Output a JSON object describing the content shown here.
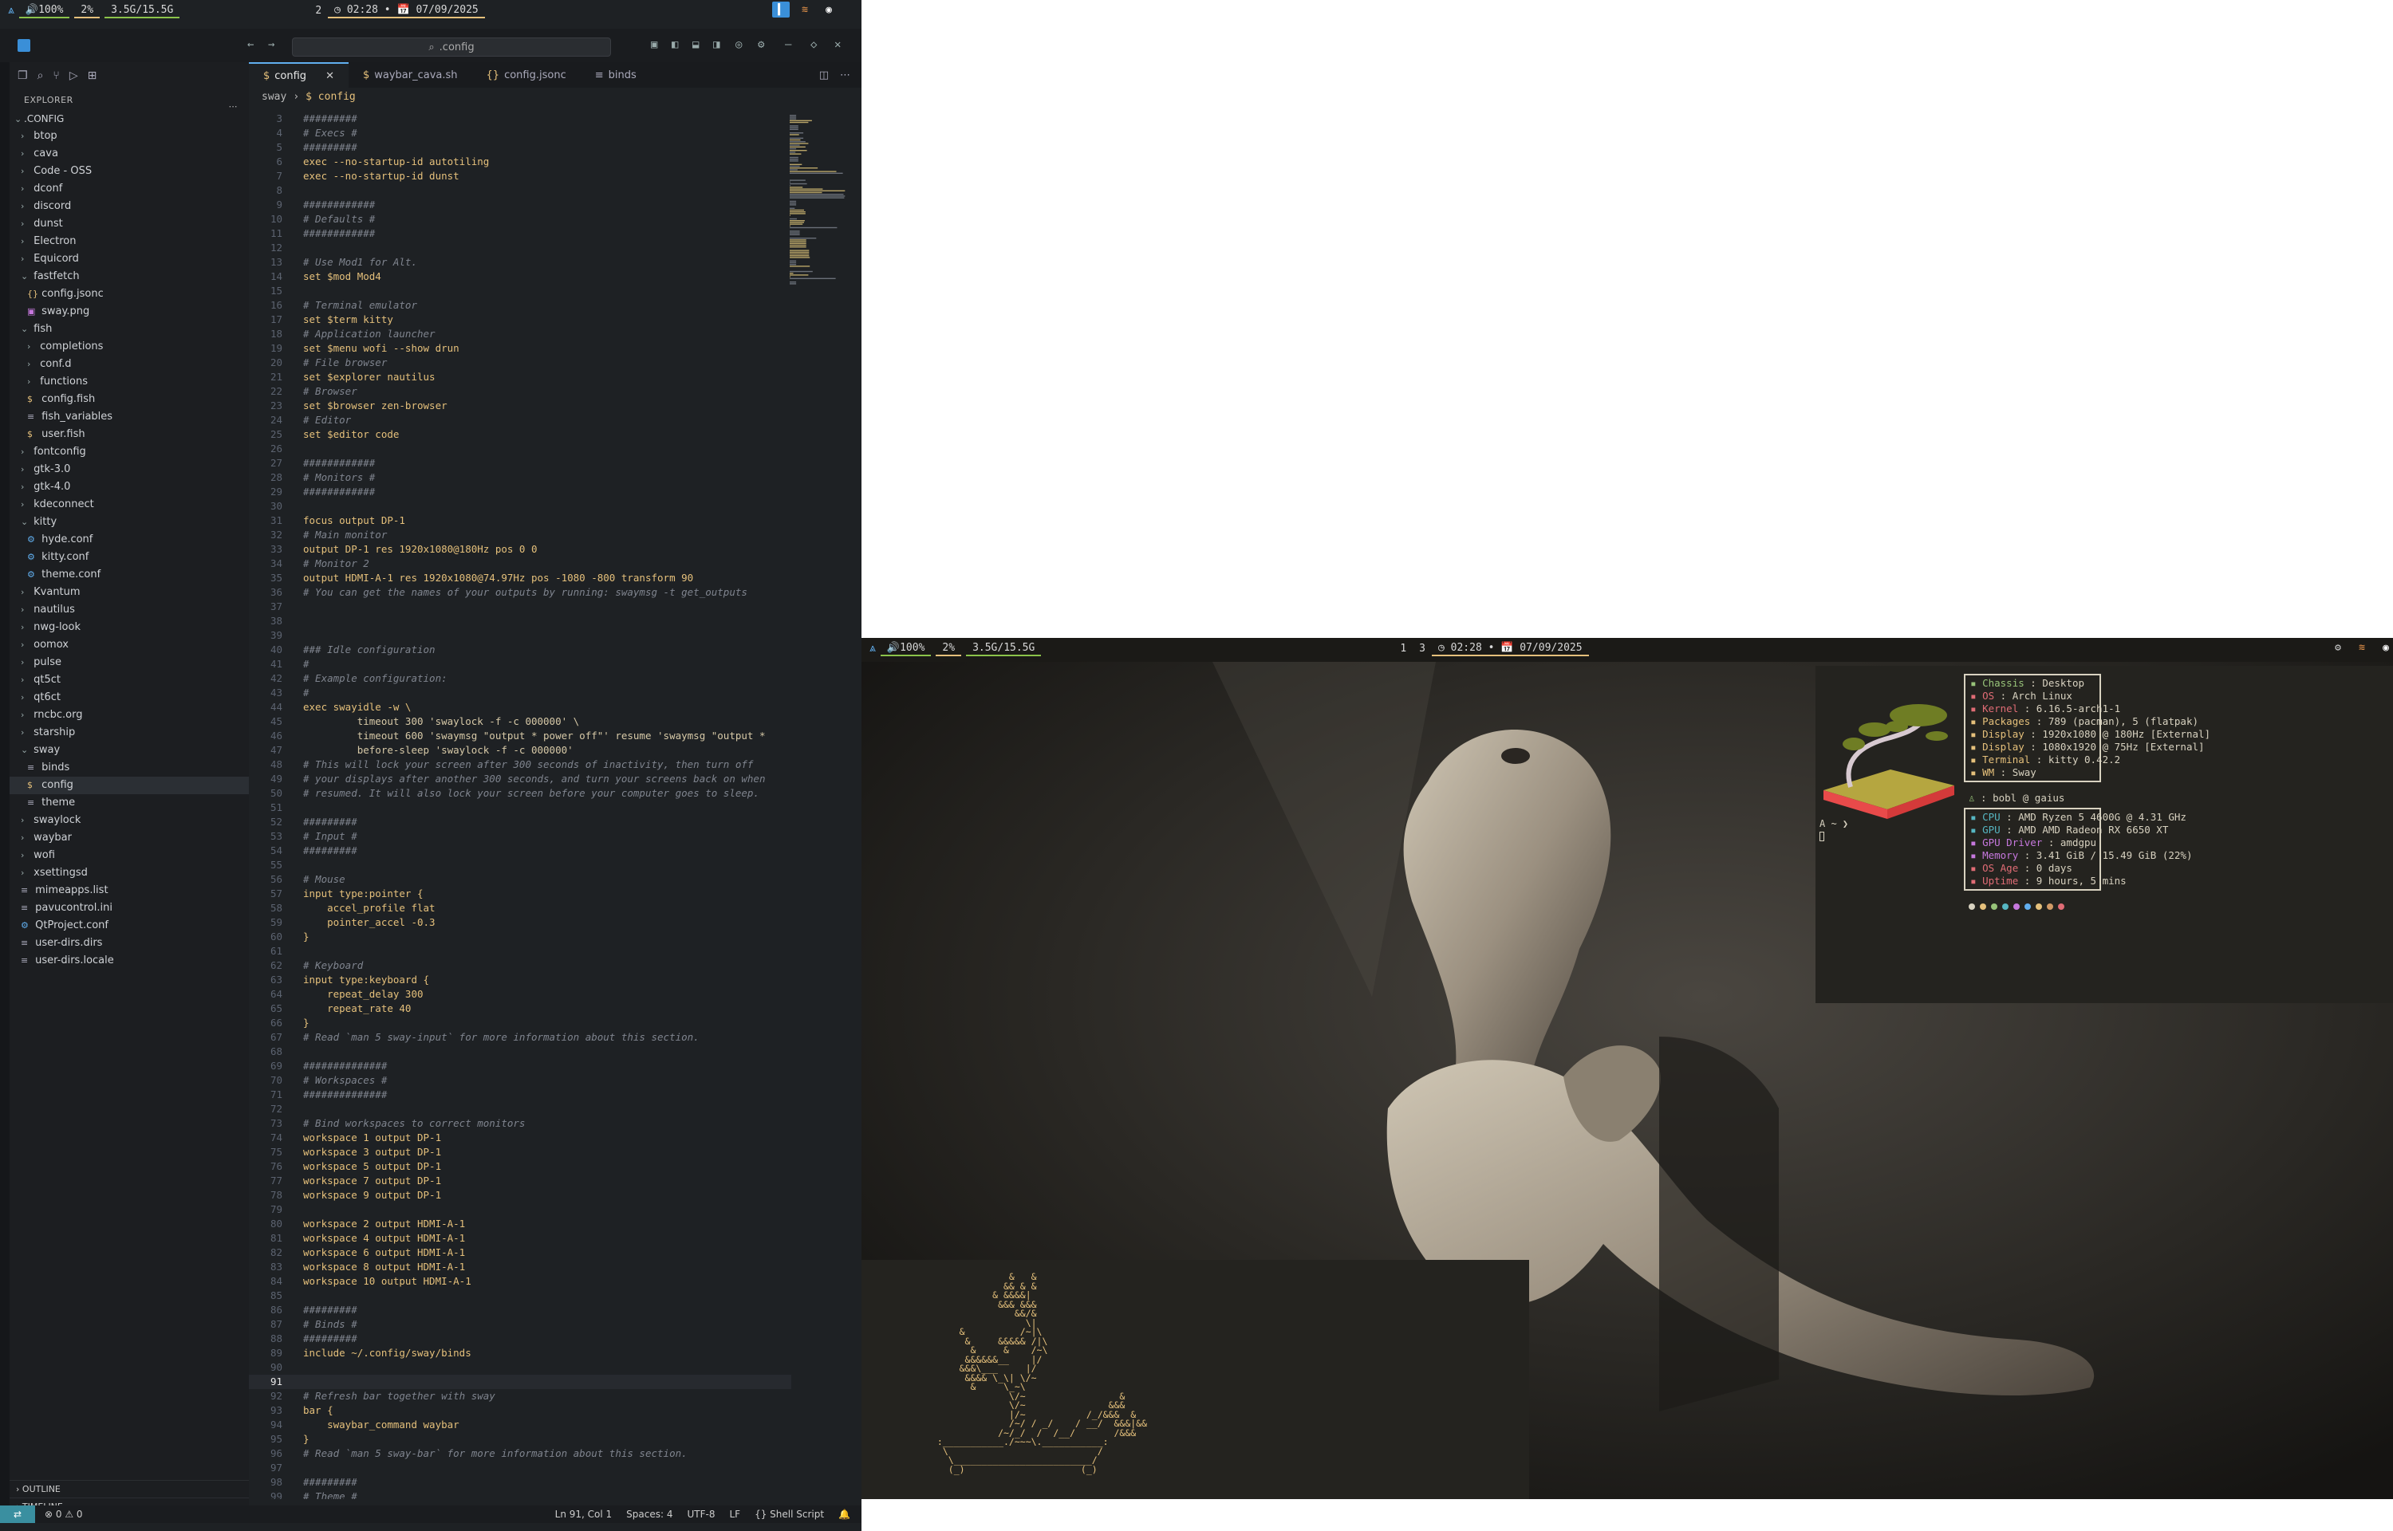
{
  "top_bar": {
    "logo": "arch-icon",
    "volume": "🔊100%",
    "cpu": "2%",
    "memory": "3.5G/15.5G",
    "workspaces": [
      "2"
    ],
    "time": "02:28",
    "date": "07/09/2025",
    "clock_text": "◷ 02:28 • 📅 07/09/2025"
  },
  "right_bar": {
    "volume": "🔊100%",
    "cpu": "2%",
    "memory": "3.5G/15.5G",
    "workspaces": [
      "1",
      "3"
    ],
    "clock_text": "◷ 02:28 • 📅 07/09/2025"
  },
  "vscode": {
    "search_placeholder": ".config",
    "explorer_title": "EXPLORER",
    "root": ".CONFIG",
    "tree": [
      {
        "name": "btop",
        "type": "folder",
        "depth": 1,
        "open": false
      },
      {
        "name": "cava",
        "type": "folder",
        "depth": 1,
        "open": false
      },
      {
        "name": "Code - OSS",
        "type": "folder",
        "depth": 1,
        "open": false
      },
      {
        "name": "dconf",
        "type": "folder",
        "depth": 1,
        "open": false
      },
      {
        "name": "discord",
        "type": "folder",
        "depth": 1,
        "open": false
      },
      {
        "name": "dunst",
        "type": "folder",
        "depth": 1,
        "open": false
      },
      {
        "name": "Electron",
        "type": "folder",
        "depth": 1,
        "open": false
      },
      {
        "name": "Equicord",
        "type": "folder",
        "depth": 1,
        "open": false
      },
      {
        "name": "fastfetch",
        "type": "folder",
        "depth": 1,
        "open": true
      },
      {
        "name": "config.jsonc",
        "type": "json",
        "depth": 2
      },
      {
        "name": "sway.png",
        "type": "img",
        "depth": 2
      },
      {
        "name": "fish",
        "type": "folder",
        "depth": 1,
        "open": true
      },
      {
        "name": "completions",
        "type": "folder",
        "depth": 2,
        "open": false
      },
      {
        "name": "conf.d",
        "type": "folder",
        "depth": 2,
        "open": false
      },
      {
        "name": "functions",
        "type": "folder",
        "depth": 2,
        "open": false
      },
      {
        "name": "config.fish",
        "type": "shell",
        "depth": 2
      },
      {
        "name": "fish_variables",
        "type": "text",
        "depth": 2
      },
      {
        "name": "user.fish",
        "type": "shell",
        "depth": 2
      },
      {
        "name": "fontconfig",
        "type": "folder",
        "depth": 1,
        "open": false
      },
      {
        "name": "gtk-3.0",
        "type": "folder",
        "depth": 1,
        "open": false
      },
      {
        "name": "gtk-4.0",
        "type": "folder",
        "depth": 1,
        "open": false
      },
      {
        "name": "kdeconnect",
        "type": "folder",
        "depth": 1,
        "open": false
      },
      {
        "name": "kitty",
        "type": "folder",
        "depth": 1,
        "open": true
      },
      {
        "name": "hyde.conf",
        "type": "gear",
        "depth": 2
      },
      {
        "name": "kitty.conf",
        "type": "gear",
        "depth": 2
      },
      {
        "name": "theme.conf",
        "type": "gear",
        "depth": 2
      },
      {
        "name": "Kvantum",
        "type": "folder",
        "depth": 1,
        "open": false
      },
      {
        "name": "nautilus",
        "type": "folder",
        "depth": 1,
        "open": false
      },
      {
        "name": "nwg-look",
        "type": "folder",
        "depth": 1,
        "open": false
      },
      {
        "name": "oomox",
        "type": "folder",
        "depth": 1,
        "open": false
      },
      {
        "name": "pulse",
        "type": "folder",
        "depth": 1,
        "open": false
      },
      {
        "name": "qt5ct",
        "type": "folder",
        "depth": 1,
        "open": false
      },
      {
        "name": "qt6ct",
        "type": "folder",
        "depth": 1,
        "open": false
      },
      {
        "name": "rncbc.org",
        "type": "folder",
        "depth": 1,
        "open": false
      },
      {
        "name": "starship",
        "type": "folder",
        "depth": 1,
        "open": false
      },
      {
        "name": "sway",
        "type": "folder",
        "depth": 1,
        "open": true
      },
      {
        "name": "binds",
        "type": "text",
        "depth": 2
      },
      {
        "name": "config",
        "type": "shell",
        "depth": 2,
        "selected": true
      },
      {
        "name": "theme",
        "type": "text",
        "depth": 2
      },
      {
        "name": "swaylock",
        "type": "folder",
        "depth": 1,
        "open": false
      },
      {
        "name": "waybar",
        "type": "folder",
        "depth": 1,
        "open": false
      },
      {
        "name": "wofi",
        "type": "folder",
        "depth": 1,
        "open": false
      },
      {
        "name": "xsettingsd",
        "type": "folder",
        "depth": 1,
        "open": false
      },
      {
        "name": "mimeapps.list",
        "type": "text",
        "depth": 1
      },
      {
        "name": "pavucontrol.ini",
        "type": "text",
        "depth": 1
      },
      {
        "name": "QtProject.conf",
        "type": "gear",
        "depth": 1
      },
      {
        "name": "user-dirs.dirs",
        "type": "text",
        "depth": 1
      },
      {
        "name": "user-dirs.locale",
        "type": "text",
        "depth": 1
      }
    ],
    "outline_label": "OUTLINE",
    "timeline_label": "TIMELINE",
    "tabs": [
      {
        "label": "config",
        "icon": "$",
        "active": true
      },
      {
        "label": "waybar_cava.sh",
        "icon": "$",
        "active": false
      },
      {
        "label": "config.jsonc",
        "icon": "{}",
        "active": false
      },
      {
        "label": "binds",
        "icon": "≡",
        "active": false
      }
    ],
    "breadcrumb": [
      "sway",
      "$ config"
    ],
    "current_line": 91,
    "code_lines": [
      [
        3,
        "#########",
        "cm"
      ],
      [
        4,
        "# Execs #",
        "cm"
      ],
      [
        5,
        "#########",
        "cm"
      ],
      [
        6,
        "exec --no-startup-id autotiling",
        "k"
      ],
      [
        7,
        "exec --no-startup-id dunst",
        "k"
      ],
      [
        8,
        "",
        ""
      ],
      [
        9,
        "############",
        "cm"
      ],
      [
        10,
        "# Defaults #",
        "cm"
      ],
      [
        11,
        "############",
        "cm"
      ],
      [
        12,
        "",
        ""
      ],
      [
        13,
        "# Use Mod1 for Alt.",
        "cm"
      ],
      [
        14,
        "set $mod Mod4",
        "k"
      ],
      [
        15,
        "",
        ""
      ],
      [
        16,
        "# Terminal emulator",
        "cm"
      ],
      [
        17,
        "set $term kitty",
        "k"
      ],
      [
        18,
        "# Application launcher",
        "cm"
      ],
      [
        19,
        "set $menu wofi --show drun",
        "k"
      ],
      [
        20,
        "# File browser",
        "cm"
      ],
      [
        21,
        "set $explorer nautilus",
        "k"
      ],
      [
        22,
        "# Browser",
        "cm"
      ],
      [
        23,
        "set $browser zen-browser",
        "k"
      ],
      [
        24,
        "# Editor",
        "cm"
      ],
      [
        25,
        "set $editor code",
        "k"
      ],
      [
        26,
        "",
        ""
      ],
      [
        27,
        "############",
        "cm"
      ],
      [
        28,
        "# Monitors #",
        "cm"
      ],
      [
        29,
        "############",
        "cm"
      ],
      [
        30,
        "",
        ""
      ],
      [
        31,
        "focus output DP-1",
        "k"
      ],
      [
        32,
        "# Main monitor",
        "cm"
      ],
      [
        33,
        "output DP-1 res 1920x1080@180Hz pos 0 0",
        "k"
      ],
      [
        34,
        "# Monitor 2",
        "cm"
      ],
      [
        35,
        "output HDMI-A-1 res 1920x1080@74.97Hz pos -1080 -800 transform 90",
        "k"
      ],
      [
        36,
        "# You can get the names of your outputs by running: swaymsg -t get_outputs",
        "cm"
      ],
      [
        37,
        "",
        ""
      ],
      [
        38,
        "",
        ""
      ],
      [
        39,
        "",
        ""
      ],
      [
        40,
        "### Idle configuration",
        "cm"
      ],
      [
        41,
        "#",
        "cm"
      ],
      [
        42,
        "# Example configuration:",
        "cm"
      ],
      [
        43,
        "#",
        "cm"
      ],
      [
        44,
        "exec swayidle -w \\",
        "k"
      ],
      [
        45,
        "         timeout 300 'swaylock -f -c 000000' \\",
        "t"
      ],
      [
        46,
        "         timeout 600 'swaymsg \"output * power off\"' resume 'swaymsg \"output *",
        "t"
      ],
      [
        47,
        "         before-sleep 'swaylock -f -c 000000'",
        "t"
      ],
      [
        48,
        "# This will lock your screen after 300 seconds of inactivity, then turn off",
        "cm"
      ],
      [
        49,
        "# your displays after another 300 seconds, and turn your screens back on when",
        "cm"
      ],
      [
        50,
        "# resumed. It will also lock your screen before your computer goes to sleep.",
        "cm"
      ],
      [
        51,
        "",
        ""
      ],
      [
        52,
        "#########",
        "cm"
      ],
      [
        53,
        "# Input #",
        "cm"
      ],
      [
        54,
        "#########",
        "cm"
      ],
      [
        55,
        "",
        ""
      ],
      [
        56,
        "# Mouse",
        "cm"
      ],
      [
        57,
        "input type:pointer {",
        "k"
      ],
      [
        58,
        "    accel_profile flat",
        "k"
      ],
      [
        59,
        "    pointer_accel -0.3",
        "k"
      ],
      [
        60,
        "}",
        "k"
      ],
      [
        61,
        "",
        ""
      ],
      [
        62,
        "# Keyboard",
        "cm"
      ],
      [
        63,
        "input type:keyboard {",
        "k"
      ],
      [
        64,
        "    repeat_delay 300",
        "k"
      ],
      [
        65,
        "    repeat_rate 40",
        "k"
      ],
      [
        66,
        "}",
        "k"
      ],
      [
        67,
        "# Read `man 5 sway-input` for more information about this section.",
        "cm"
      ],
      [
        68,
        "",
        ""
      ],
      [
        69,
        "##############",
        "cm"
      ],
      [
        70,
        "# Workspaces #",
        "cm"
      ],
      [
        71,
        "##############",
        "cm"
      ],
      [
        72,
        "",
        ""
      ],
      [
        73,
        "# Bind workspaces to correct monitors",
        "cm"
      ],
      [
        74,
        "workspace 1 output DP-1",
        "k"
      ],
      [
        75,
        "workspace 3 output DP-1",
        "k"
      ],
      [
        76,
        "workspace 5 output DP-1",
        "k"
      ],
      [
        77,
        "workspace 7 output DP-1",
        "k"
      ],
      [
        78,
        "workspace 9 output DP-1",
        "k"
      ],
      [
        79,
        "",
        ""
      ],
      [
        80,
        "workspace 2 output HDMI-A-1",
        "k"
      ],
      [
        81,
        "workspace 4 output HDMI-A-1",
        "k"
      ],
      [
        82,
        "workspace 6 output HDMI-A-1",
        "k"
      ],
      [
        83,
        "workspace 8 output HDMI-A-1",
        "k"
      ],
      [
        84,
        "workspace 10 output HDMI-A-1",
        "k"
      ],
      [
        85,
        "",
        ""
      ],
      [
        86,
        "#########",
        "cm"
      ],
      [
        87,
        "# Binds #",
        "cm"
      ],
      [
        88,
        "#########",
        "cm"
      ],
      [
        89,
        "include ~/.config/sway/binds",
        "k"
      ],
      [
        90,
        "",
        ""
      ],
      [
        91,
        "",
        ""
      ],
      [
        92,
        "# Refresh bar together with sway",
        "cm"
      ],
      [
        93,
        "bar {",
        "k"
      ],
      [
        94,
        "    swaybar_command waybar",
        "k"
      ],
      [
        95,
        "}",
        "k"
      ],
      [
        96,
        "# Read `man 5 sway-bar` for more information about this section.",
        "cm"
      ],
      [
        97,
        "",
        ""
      ],
      [
        98,
        "#########",
        "cm"
      ],
      [
        99,
        "# Theme #",
        "cm"
      ]
    ],
    "status": {
      "remote": "⇄",
      "problems": "⊗ 0 ⚠ 0",
      "position": "Ln 91, Col 1",
      "spaces": "Spaces: 4",
      "encoding": "UTF-8",
      "eol": "LF",
      "language": "{} Shell Script",
      "bell": "🔔"
    }
  },
  "fastfetch": {
    "hw": [
      {
        "k": "Chassis",
        "v": "Desktop",
        "color": "#98c379"
      },
      {
        "k": "OS",
        "v": "Arch Linux",
        "color": "#e06c75"
      },
      {
        "k": "Kernel",
        "v": "6.16.5-arch1-1",
        "color": "#e06c75"
      },
      {
        "k": "Packages",
        "v": "789 (pacman), 5 (flatpak)",
        "color": "#e5c07b"
      },
      {
        "k": "Display",
        "v": "1920x1080 @ 180Hz [External]",
        "color": "#e5c07b"
      },
      {
        "k": "Display",
        "v": "1080x1920 @ 75Hz [External]",
        "color": "#e5c07b"
      },
      {
        "k": "Terminal",
        "v": "kitty 0.42.2",
        "color": "#e5c07b"
      },
      {
        "k": "WM",
        "v": "Sway",
        "color": "#e5c07b"
      }
    ],
    "user": "bobl @ gaius",
    "sys": [
      {
        "k": "CPU",
        "v": "AMD Ryzen 5 4600G @ 4.31 GHz",
        "color": "#56b6c2"
      },
      {
        "k": "GPU",
        "v": "AMD AMD Radeon RX 6650 XT",
        "color": "#56b6c2"
      },
      {
        "k": "GPU Driver",
        "v": "amdgpu",
        "color": "#c678dd"
      },
      {
        "k": "Memory",
        "v": "3.41 GiB / 15.49 GiB (22%)",
        "color": "#c678dd"
      },
      {
        "k": "OS Age",
        "v": "0 days",
        "color": "#e06c75"
      },
      {
        "k": "Uptime",
        "v": "9 hours, 5 mins",
        "color": "#e06c75"
      }
    ],
    "palette": [
      "#d8d2c0",
      "#e5c07b",
      "#98c379",
      "#56b6c2",
      "#c678dd",
      "#61afef",
      "#e5c07b",
      "#d19a66",
      "#e06c75"
    ],
    "prompt": "A ~ ❯"
  },
  "cbonsai_art": [
    "              &   &",
    "             && & &",
    "           & &&&&|",
    "            &&& &&&",
    "               &&/&",
    "                 \\|",
    "     &          /~|\\",
    "      &     &&&&& /|\\",
    "       &     &    /~\\",
    "      &&&&&&__    |/",
    "     &&&\\___     |/",
    "      &&&& \\_\\| \\/~",
    "       &     \\_~\\",
    "              \\/~                 &",
    "              \\/~               &&&",
    "              |/~           /_/&&&  &",
    "              /~/ / _/    / __/  &&&|&&",
    "            /~/_/  /  /__/       /&&&",
    " :___________./~~~\\.___________:",
    "  \\                           /",
    "   \\_________________________/",
    "   (_)                     (_)"
  ]
}
